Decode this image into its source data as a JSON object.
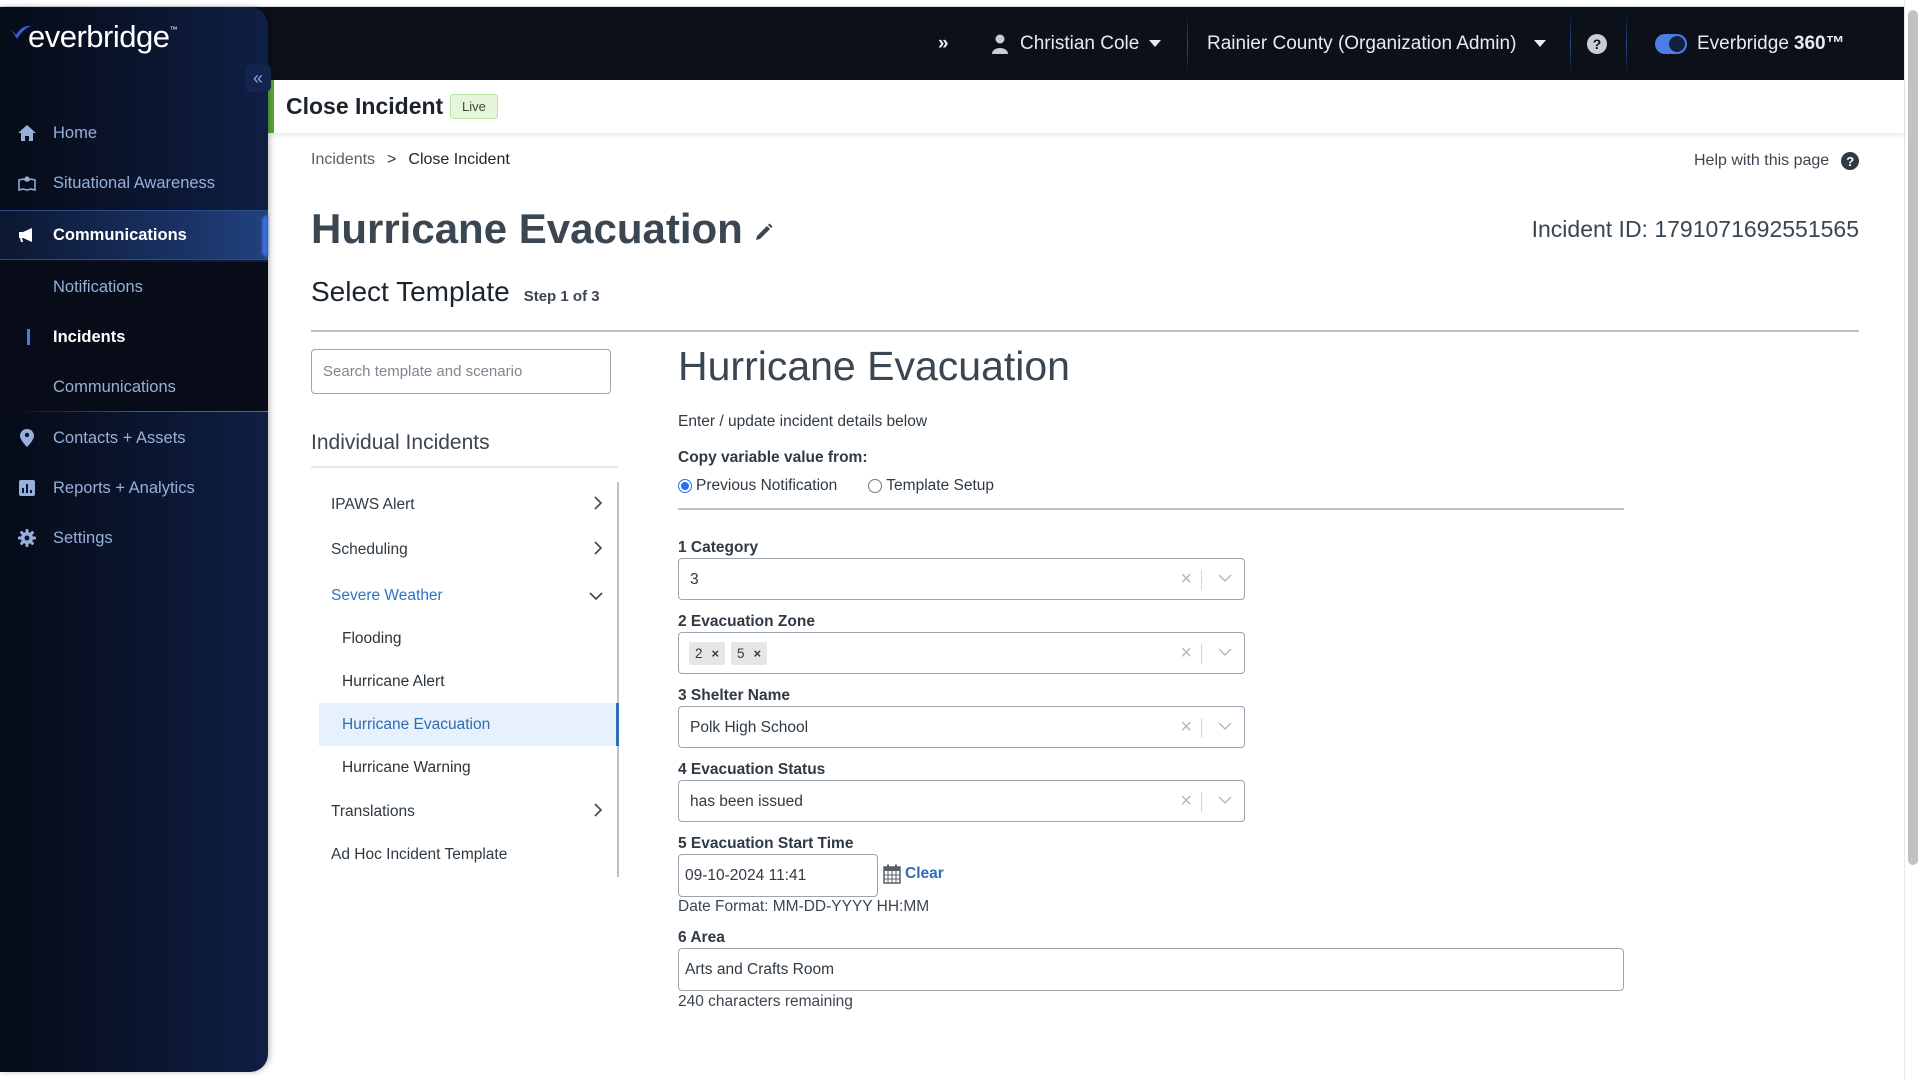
{
  "brand": {
    "logo_text": "everbridge",
    "logo_tm": "™",
    "accent": "#2f6cb5",
    "live_green": "#5aa83a"
  },
  "topbar": {
    "expand_icon": "»",
    "user_name": "Christian Cole",
    "organization": "Rainier County (Organization Admin)",
    "help_icon": "?",
    "product_label": "Everbridge",
    "product_suffix": "360™",
    "product_toggle_on": true
  },
  "sidebar": {
    "collapse_icon": "«",
    "items": [
      {
        "label": "Home",
        "icon": "home-icon"
      },
      {
        "label": "Situational Awareness",
        "icon": "map-icon"
      },
      {
        "label": "Communications",
        "icon": "megaphone-icon",
        "active": true
      },
      {
        "label": "Contacts + Assets",
        "icon": "location-pin-icon"
      },
      {
        "label": "Reports + Analytics",
        "icon": "bar-chart-icon"
      },
      {
        "label": "Settings",
        "icon": "gear-icon"
      }
    ],
    "submenu": [
      {
        "label": "Notifications"
      },
      {
        "label": "Incidents",
        "active": true
      },
      {
        "label": "Communications"
      }
    ]
  },
  "header": {
    "title": "Close Incident",
    "status_badge": "Live"
  },
  "breadcrumb": {
    "parent": "Incidents",
    "separator": ">",
    "current": "Close Incident"
  },
  "help": {
    "label": "Help with this page"
  },
  "incident": {
    "title": "Hurricane Evacuation",
    "id_label": "Incident ID: 1791071692551565"
  },
  "step": {
    "title": "Select Template",
    "label": "Step 1 of 3"
  },
  "template_panel": {
    "search_placeholder": "Search template and scenario",
    "search_value": "",
    "section_title": "Individual Incidents",
    "items": [
      {
        "label": "IPAWS Alert",
        "type": "folder",
        "expanded": false
      },
      {
        "label": "Scheduling",
        "type": "folder",
        "expanded": false
      },
      {
        "label": "Severe Weather",
        "type": "folder",
        "expanded": true
      },
      {
        "label": "Flooding",
        "type": "template"
      },
      {
        "label": "Hurricane Alert",
        "type": "template"
      },
      {
        "label": "Hurricane Evacuation",
        "type": "template",
        "selected": true
      },
      {
        "label": "Hurricane Warning",
        "type": "template"
      },
      {
        "label": "Translations",
        "type": "folder",
        "expanded": false
      },
      {
        "label": "Ad Hoc Incident Template",
        "type": "template"
      }
    ]
  },
  "form": {
    "title": "Hurricane Evacuation",
    "subtitle": "Enter / update incident details below",
    "copy_label": "Copy variable value from:",
    "copy_options": [
      {
        "label": "Previous Notification",
        "checked": true
      },
      {
        "label": "Template Setup",
        "checked": false
      }
    ],
    "fields": [
      {
        "label": "1 Category",
        "type": "select",
        "value": "3"
      },
      {
        "label": "2 Evacuation Zone",
        "type": "multiselect",
        "values": [
          "2",
          "5"
        ]
      },
      {
        "label": "3 Shelter Name",
        "type": "select",
        "value": "Polk High School"
      },
      {
        "label": "4 Evacuation Status",
        "type": "select",
        "value": "has been issued"
      },
      {
        "label": "5 Evacuation Start Time",
        "type": "datetime",
        "value": "09-10-2024 11:41",
        "clear_label": "Clear",
        "hint": "Date Format: MM-DD-YYYY HH:MM"
      },
      {
        "label": "6 Area",
        "type": "text",
        "value": "Arts and Crafts Room",
        "hint": "240 characters remaining"
      }
    ],
    "clear_icon": "×",
    "chip_remove_icon": "×"
  }
}
